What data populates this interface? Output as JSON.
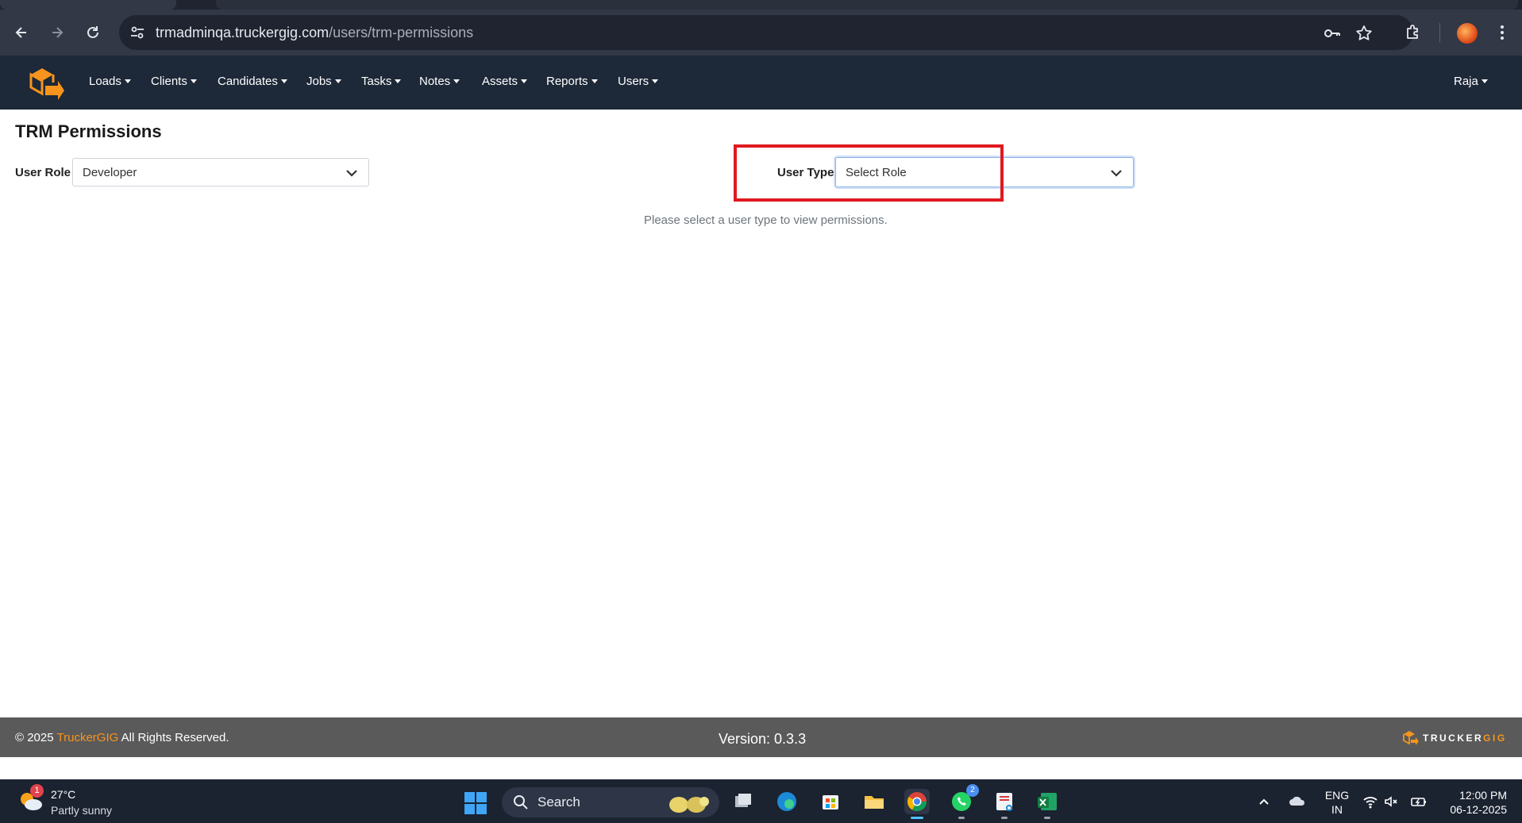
{
  "browser": {
    "url_host": "trmadminqa.truckergig.com",
    "url_path": "/users/trm-permissions"
  },
  "navbar": {
    "items": [
      {
        "label": "Loads"
      },
      {
        "label": "Clients"
      },
      {
        "label": "Candidates"
      },
      {
        "label": "Jobs"
      },
      {
        "label": "Tasks"
      },
      {
        "label": "Notes"
      },
      {
        "label": "Assets"
      },
      {
        "label": "Reports"
      },
      {
        "label": "Users"
      }
    ],
    "user_name": "Raja"
  },
  "page": {
    "title": "TRM Permissions",
    "user_role_label": "User Role :",
    "user_role_value": "Developer",
    "user_type_label": "User Type :",
    "user_type_value": "Select Role",
    "hint": "Please select a user type to view permissions."
  },
  "footer": {
    "copyright_prefix": "© 2025",
    "brand": "TruckerGIG",
    "copyright_suffix": "All Rights Reserved.",
    "version": "Version: 0.3.3",
    "logo_text_a": "TRUCKER",
    "logo_text_b": "GIG"
  },
  "taskbar": {
    "weather_badge": "1",
    "weather_temp": "27°C",
    "weather_desc": "Partly sunny",
    "search_label": "Search",
    "whatsapp_badge": "2",
    "lang_line1": "ENG",
    "lang_line2": "IN",
    "time": "12:00 PM",
    "date": "06-12-2025"
  },
  "colors": {
    "navbar_bg": "#1d2838",
    "brand_orange": "#f7941d",
    "highlight_red": "#e0191f",
    "footer_bg": "#5a5a5a"
  },
  "icons": [
    "back-arrow-icon",
    "forward-arrow-icon",
    "reload-icon",
    "site-info-icon",
    "password-key-icon",
    "bookmark-star-icon",
    "extensions-icon",
    "menu-dots-icon",
    "chevron-down-icon",
    "windows-start-icon",
    "search-icon"
  ]
}
